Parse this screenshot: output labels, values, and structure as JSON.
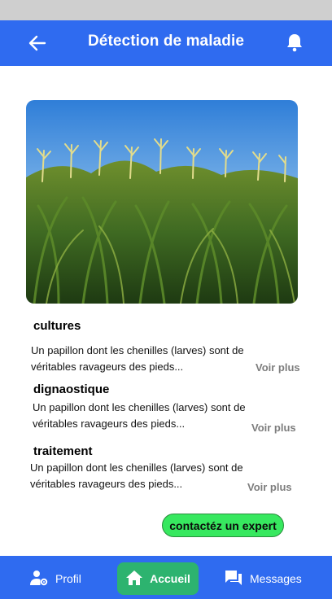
{
  "header": {
    "title": "Détection de maladie",
    "back_icon": "arrow-left-icon",
    "notification_icon": "bell-icon",
    "color": "#2f6bf0"
  },
  "hero_image": {
    "subject": "corn-field-photo"
  },
  "sections": [
    {
      "title": "cultures",
      "line1": "Un papillon dont les chenilles (larves) sont de",
      "line2": "véritables ravageurs des pieds...",
      "more": "Voir plus"
    },
    {
      "title": "dignaostique",
      "line1": "Un papillon dont les chenilles (larves) sont de",
      "line2": "véritables ravageurs des pieds...",
      "more": "Voir plus"
    },
    {
      "title": "traitement",
      "line1": "Un papillon dont les chenilles (larves) sont de",
      "line2": "véritables ravageurs des pieds...",
      "more": "Voir plus"
    }
  ],
  "expert_button": {
    "label": "contactéz un expert",
    "color": "#37e85f"
  },
  "bottom_nav": {
    "items": [
      {
        "label": "Profil",
        "icon": "user-settings-icon",
        "active": false
      },
      {
        "label": "Accueil",
        "icon": "home-icon",
        "active": true
      },
      {
        "label": "Messages",
        "icon": "chat-icon",
        "active": false
      }
    ],
    "active_color": "#2db36f"
  }
}
